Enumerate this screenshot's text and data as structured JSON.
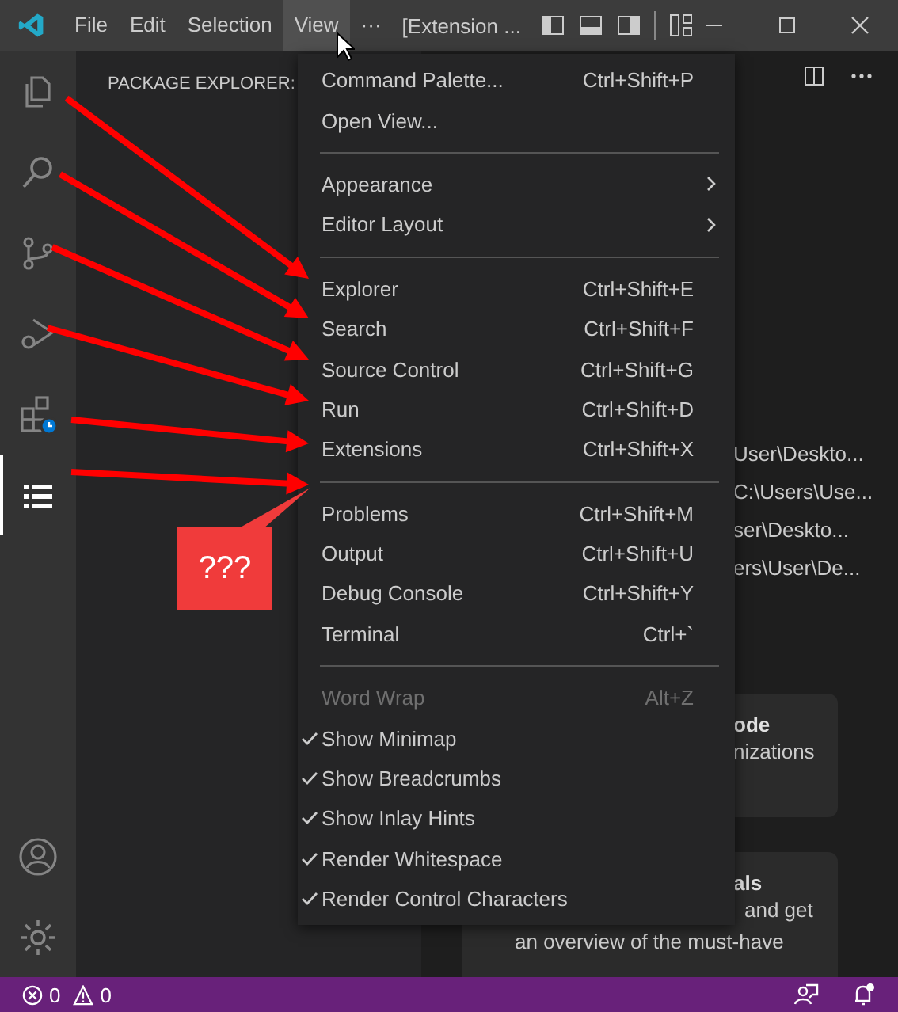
{
  "title_bar": {
    "menus": [
      {
        "label": "File",
        "selected": false
      },
      {
        "label": "Edit",
        "selected": false
      },
      {
        "label": "Selection",
        "selected": false
      },
      {
        "label": "View",
        "selected": true
      }
    ],
    "more": "···",
    "title": "[Extension ..."
  },
  "activity_bar": {
    "items": [
      {
        "kind": "files",
        "selected": false
      },
      {
        "kind": "search",
        "selected": false
      },
      {
        "kind": "source-control",
        "selected": false
      },
      {
        "kind": "run",
        "selected": false
      },
      {
        "kind": "extensions",
        "selected": false
      },
      {
        "kind": "list",
        "selected": true
      }
    ]
  },
  "sidebar": {
    "header": "PACKAGE EXPLORER:"
  },
  "editor": {
    "recent": [
      "User\\Deskto...",
      "C:\\Users\\Use...",
      "ser\\Deskto...",
      "ers\\User\\De..."
    ],
    "cards": [
      {
        "title": "ode",
        "lines": [
          "nizations"
        ]
      },
      {
        "title": "als",
        "lines": [
          "and get",
          "an overview of the must-have"
        ]
      }
    ]
  },
  "menu": {
    "groups": [
      [
        {
          "label": "Command Palette...",
          "shortcut": "Ctrl+Shift+P",
          "submenu": false,
          "checked": false,
          "disabled": false
        },
        {
          "label": "Open View...",
          "submenu": false,
          "checked": false,
          "disabled": false
        }
      ],
      [
        {
          "label": "Appearance",
          "submenu": true,
          "checked": false,
          "disabled": false
        },
        {
          "label": "Editor Layout",
          "submenu": true,
          "checked": false,
          "disabled": false
        }
      ],
      [
        {
          "label": "Explorer",
          "shortcut": "Ctrl+Shift+E",
          "submenu": false,
          "checked": false,
          "disabled": false
        },
        {
          "label": "Search",
          "shortcut": "Ctrl+Shift+F",
          "submenu": false,
          "checked": false,
          "disabled": false
        },
        {
          "label": "Source Control",
          "shortcut": "Ctrl+Shift+G",
          "submenu": false,
          "checked": false,
          "disabled": false
        },
        {
          "label": "Run",
          "shortcut": "Ctrl+Shift+D",
          "submenu": false,
          "checked": false,
          "disabled": false
        },
        {
          "label": "Extensions",
          "shortcut": "Ctrl+Shift+X",
          "submenu": false,
          "checked": false,
          "disabled": false
        }
      ],
      [
        {
          "label": "Problems",
          "shortcut": "Ctrl+Shift+M",
          "submenu": false,
          "checked": false,
          "disabled": false
        },
        {
          "label": "Output",
          "shortcut": "Ctrl+Shift+U",
          "submenu": false,
          "checked": false,
          "disabled": false
        },
        {
          "label": "Debug Console",
          "shortcut": "Ctrl+Shift+Y",
          "submenu": false,
          "checked": false,
          "disabled": false
        },
        {
          "label": "Terminal",
          "shortcut": "Ctrl+`",
          "submenu": false,
          "checked": false,
          "disabled": false
        }
      ],
      [
        {
          "label": "Word Wrap",
          "shortcut": "Alt+Z",
          "submenu": false,
          "checked": false,
          "disabled": true
        },
        {
          "label": "Show Minimap",
          "submenu": false,
          "checked": true,
          "disabled": false
        },
        {
          "label": "Show Breadcrumbs",
          "submenu": false,
          "checked": true,
          "disabled": false
        },
        {
          "label": "Show Inlay Hints",
          "submenu": false,
          "checked": true,
          "disabled": false
        },
        {
          "label": "Render Whitespace",
          "submenu": false,
          "checked": true,
          "disabled": false
        },
        {
          "label": "Render Control Characters",
          "submenu": false,
          "checked": true,
          "disabled": false
        }
      ]
    ]
  },
  "annotation": {
    "callout": "???"
  },
  "status_bar": {
    "errors": "0",
    "warnings": "0"
  }
}
